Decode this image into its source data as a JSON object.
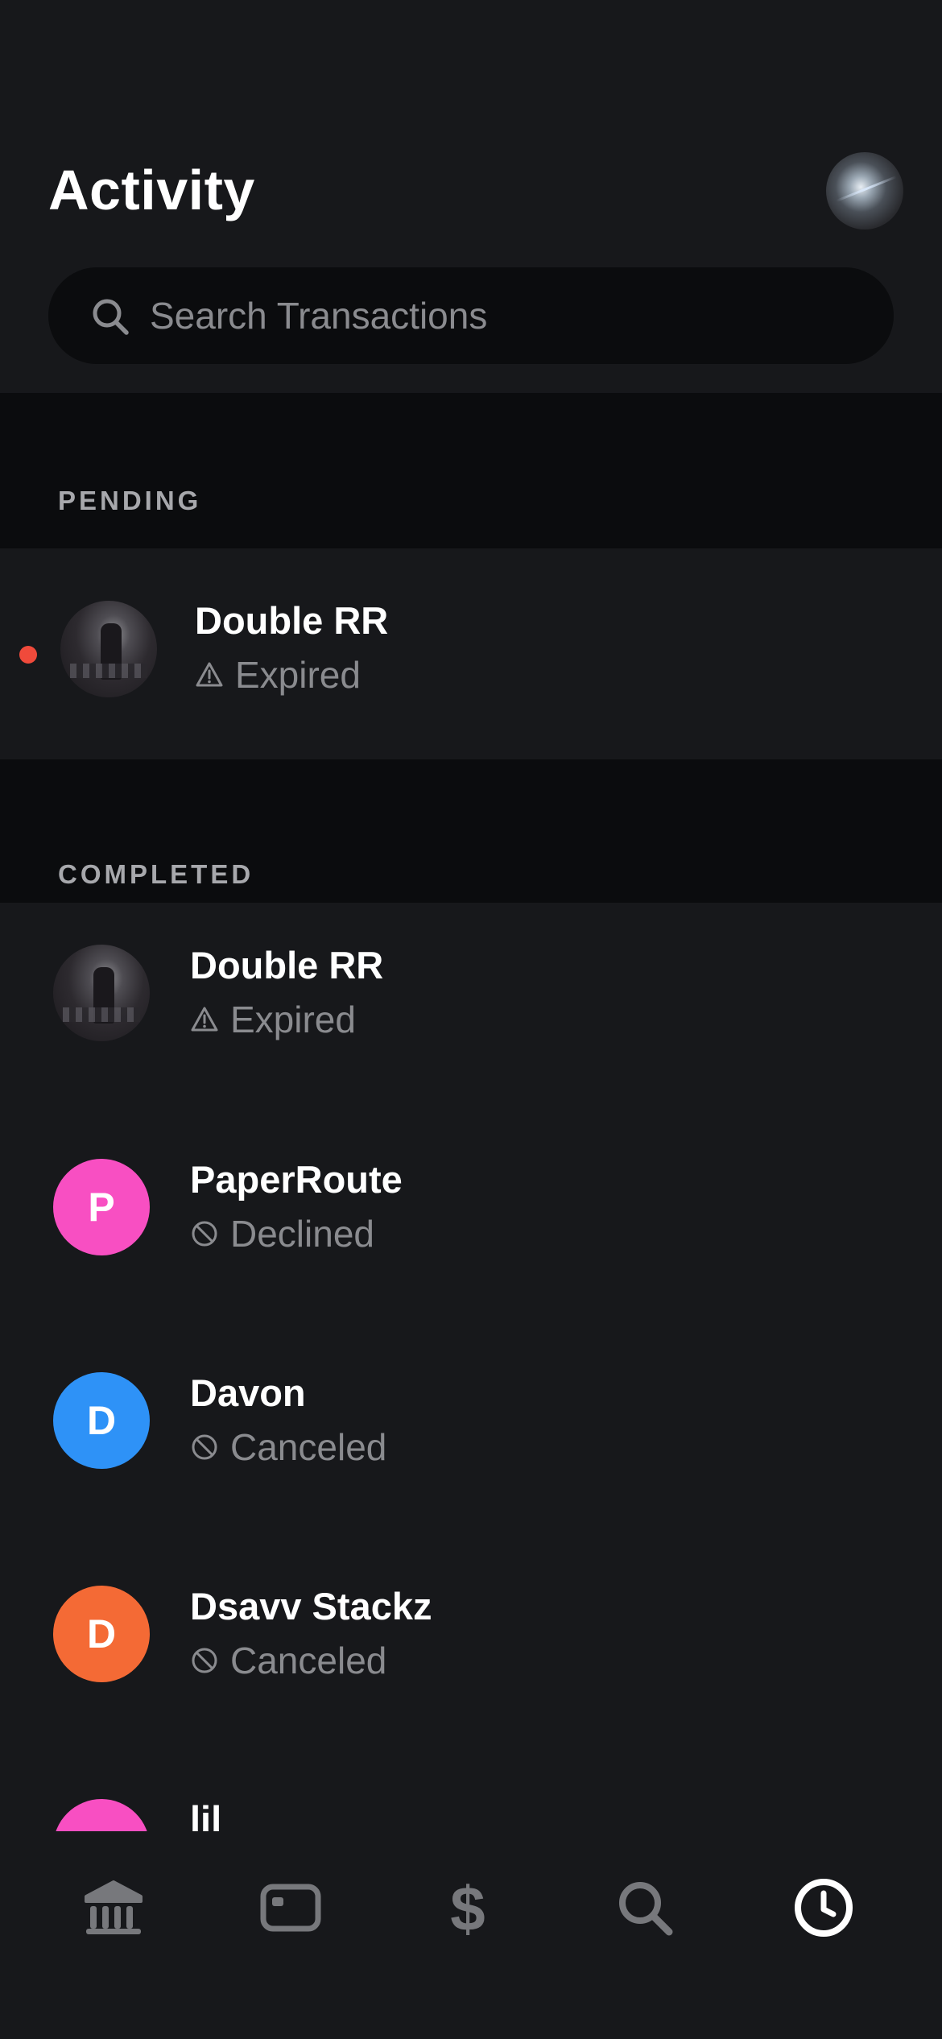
{
  "header": {
    "title": "Activity",
    "search_placeholder": "Search Transactions"
  },
  "sections": {
    "pending_label": "PENDING",
    "completed_label": "COMPLETED"
  },
  "pending": [
    {
      "name": "Double RR",
      "status": "Expired",
      "status_icon": "warning-icon",
      "unread": true
    }
  ],
  "completed": [
    {
      "name": "Double RR",
      "status": "Expired",
      "status_icon": "warning-icon",
      "avatar_type": "photo"
    },
    {
      "name": "PaperRoute",
      "status": "Declined",
      "status_icon": "blocked-icon",
      "initial": "P",
      "avatar_color": "#f84fc2"
    },
    {
      "name": "Davon",
      "status": "Canceled",
      "status_icon": "blocked-icon",
      "initial": "D",
      "avatar_color": "#2e92f7"
    },
    {
      "name": "Dsavv Stackz",
      "status": "Canceled",
      "status_icon": "blocked-icon",
      "initial": "D",
      "avatar_color": "#f46a35"
    },
    {
      "name": "lil",
      "status": "",
      "avatar_color": "#f84fc2"
    }
  ],
  "nav": {
    "items": [
      "bank-icon",
      "card-icon",
      "dollar-icon",
      "search-icon",
      "activity-clock-icon"
    ],
    "active": "activity-clock-icon"
  },
  "colors": {
    "background": "#17181b",
    "section_background": "#0b0c0e",
    "unread_dot": "#f04a3b",
    "muted_text": "#8a8b8f"
  }
}
